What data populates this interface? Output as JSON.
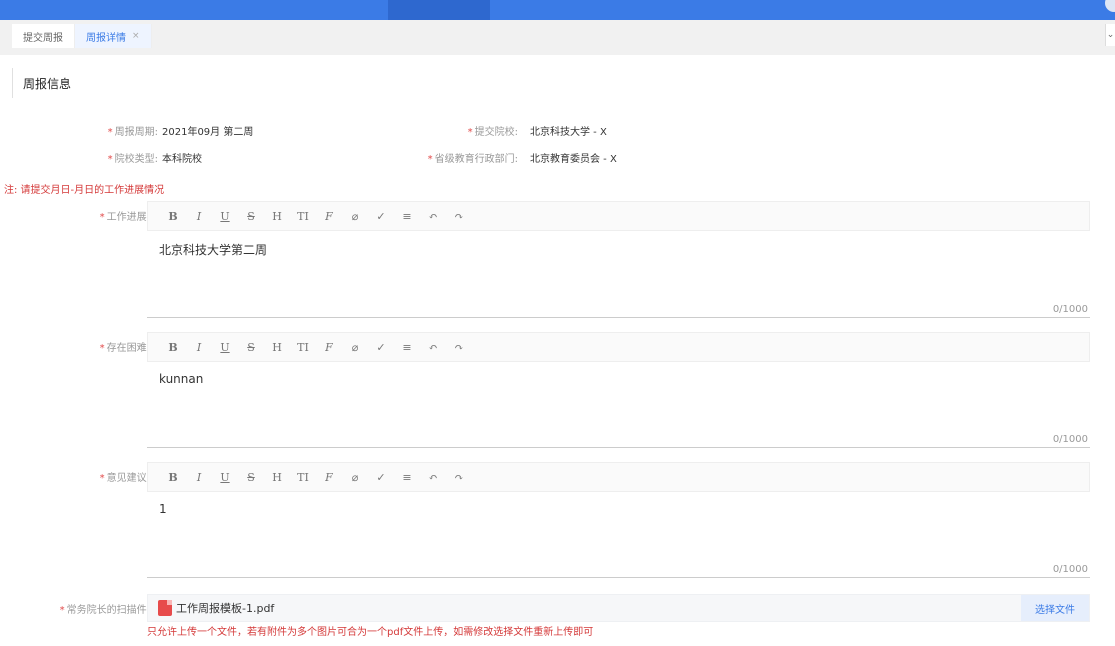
{
  "tabs": [
    {
      "label": "提交周报",
      "active": false,
      "closable": false
    },
    {
      "label": "周报详情",
      "active": true,
      "closable": true
    }
  ],
  "tab_close_glyph": "×",
  "tab_scroll_glyph": "⌄",
  "section_title": "周报信息",
  "required_mark": "*",
  "info": {
    "week_label": "周报周期:",
    "week_value": "2021年09月 第二周",
    "school_label": "提交院校:",
    "school_value": "北京科技大学 - X",
    "type_label": "院校类型:",
    "type_value": "本科院校",
    "dept_label": "省级教育行政部门:",
    "dept_value": "北京教育委员会 - X"
  },
  "note": "注: 请提交月日-月日的工作进展情况",
  "toolbar_buttons": [
    "B",
    "I",
    "U",
    "S",
    "H",
    "TI",
    "F",
    "⌀",
    "✓",
    "≡",
    "↶",
    "↷"
  ],
  "editors": [
    {
      "label": "工作进展:",
      "content": "北京科技大学第二周",
      "counter": "0/1000"
    },
    {
      "label": "存在困难:",
      "content": "kunnan",
      "counter": "0/1000"
    },
    {
      "label": "意见建议:",
      "content": "1",
      "counter": "0/1000"
    }
  ],
  "upload": {
    "label": "常务院长的扫描件:",
    "file_name": "工作周报模板-1.pdf",
    "button": "选择文件",
    "hint": "只允许上传一个文件，若有附件为多个图片可合为一个pdf文件上传，如需修改选择文件重新上传即可"
  },
  "colors": {
    "primary": "#3b7be6",
    "danger": "#d43838"
  }
}
